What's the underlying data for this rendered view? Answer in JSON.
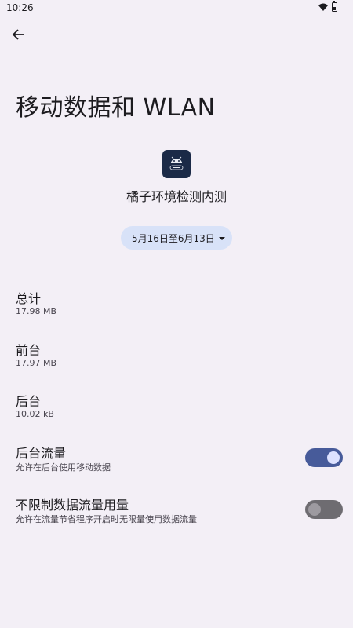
{
  "status_bar": {
    "time": "10:26"
  },
  "page": {
    "title": "移动数据和 WLAN"
  },
  "app": {
    "name": "橘子环境检测内测",
    "icon": "android-robot-icon"
  },
  "date_range": {
    "label": "5月16日至6月13日"
  },
  "usage": [
    {
      "title": "总计",
      "value": "17.98 MB"
    },
    {
      "title": "前台",
      "value": "17.97 MB"
    },
    {
      "title": "后台",
      "value": "10.02 kB"
    }
  ],
  "settings": [
    {
      "title": "后台流量",
      "summary": "允许在后台使用移动数据",
      "enabled": true
    },
    {
      "title": "不限制数据流量用量",
      "summary": "允许在流量节省程序开启时无限量使用数据流量",
      "enabled": false
    }
  ],
  "colors": {
    "background": "#f3eff6",
    "accent": "#475b9a",
    "chip": "#d8e2f8"
  }
}
